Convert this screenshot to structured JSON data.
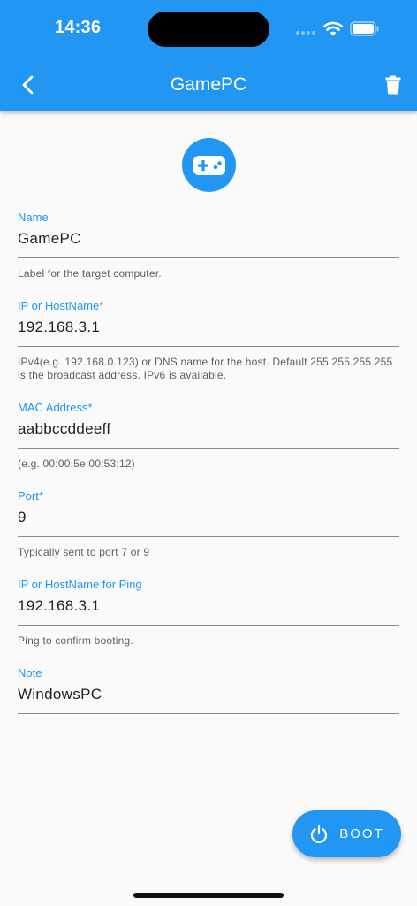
{
  "status_bar": {
    "time": "14:36"
  },
  "app_bar": {
    "title": "GamePC",
    "back_icon": "chevron-left-icon",
    "delete_icon": "trash-icon"
  },
  "avatar_icon": "gamepad-icon",
  "fields": [
    {
      "label": "Name",
      "value": "GamePC",
      "helper": "Label for the target computer."
    },
    {
      "label": "IP or HostName*",
      "value": "192.168.3.1",
      "helper": "IPv4(e.g. 192.168.0.123) or DNS name for the host. Default 255.255.255.255 is the broadcast address. IPv6 is available."
    },
    {
      "label": "MAC Address*",
      "value": "aabbccddeeff",
      "helper": "(e.g. 00:00:5e:00:53:12)"
    },
    {
      "label": "Port*",
      "value": "9",
      "helper": "Typically sent to port 7 or 9"
    },
    {
      "label": "IP or HostName for Ping",
      "value": "192.168.3.1",
      "helper": "Ping to confirm booting."
    },
    {
      "label": "Note",
      "value": "WindowsPC",
      "helper": ""
    }
  ],
  "boot_button": {
    "label": "BOOT",
    "icon": "power-icon"
  },
  "colors": {
    "primary": "#2196f3",
    "background": "#fafafa",
    "text": "#222222",
    "helper_text": "#5f5f5f"
  }
}
